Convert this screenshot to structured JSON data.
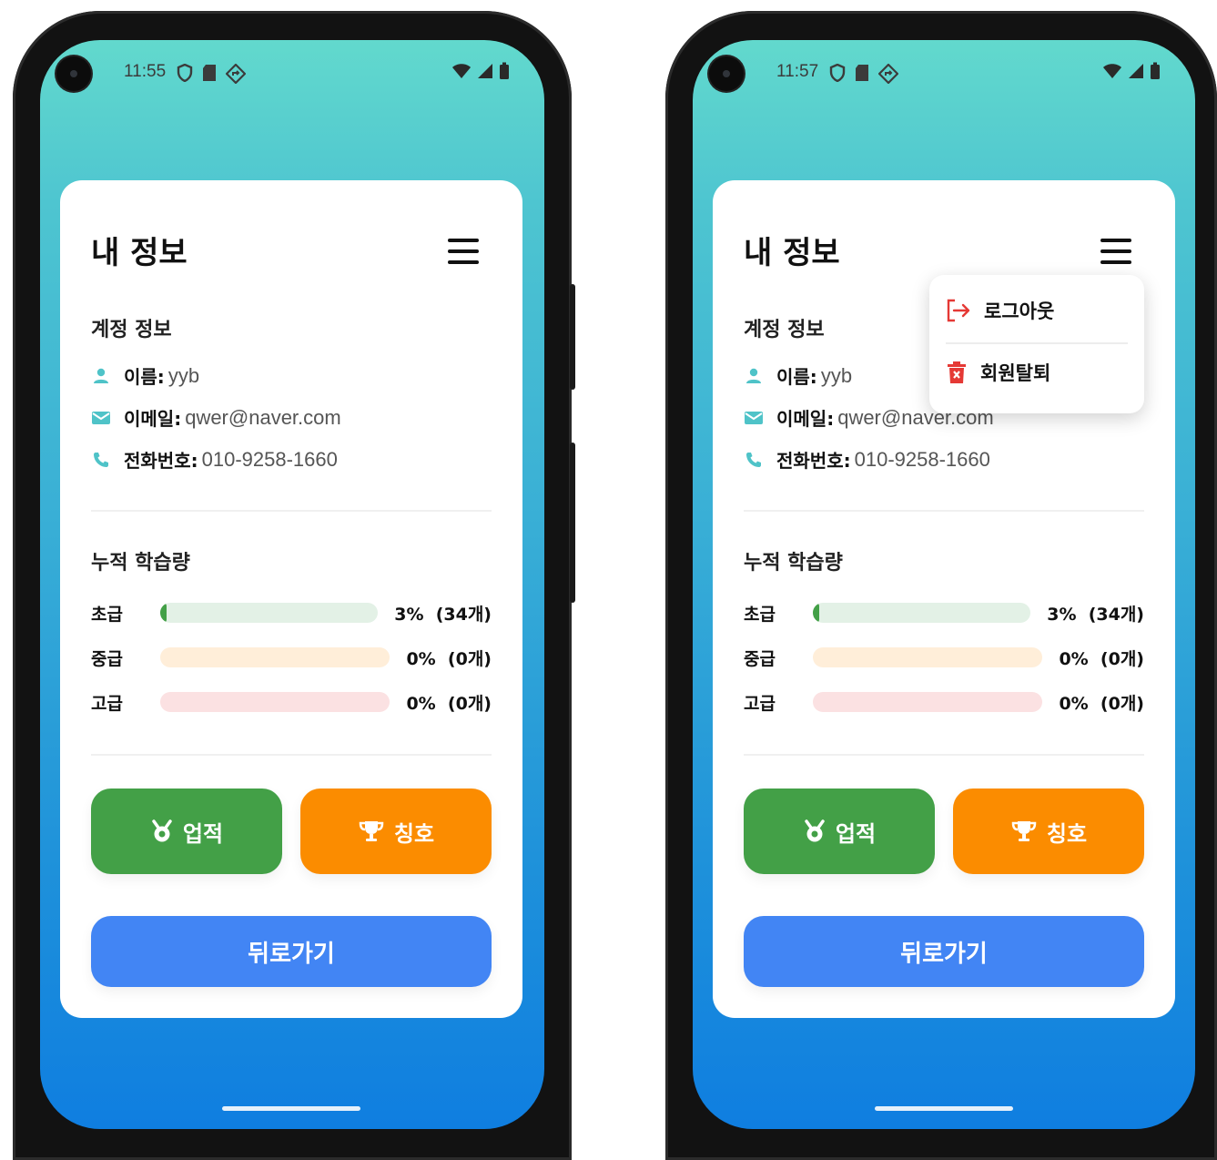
{
  "screens": [
    {
      "status": {
        "time": "11:55"
      },
      "title": "내 정보",
      "account": {
        "heading": "계정 정보",
        "name_label": "이름:",
        "name_value": "yyb",
        "email_label": "이메일:",
        "email_value": "qwer@naver.com",
        "phone_label": "전화번호:",
        "phone_value": "010-9258-1660"
      },
      "progress": {
        "heading": "누적 학습량",
        "rows": [
          {
            "label": "초급",
            "percent": 3,
            "text": "3%  (34개)",
            "track": "#e3f1e6",
            "fill": "#43a047"
          },
          {
            "label": "중급",
            "percent": 0,
            "text": "0%  (0개)",
            "track": "#ffeed9",
            "fill": "#fb8c00"
          },
          {
            "label": "고급",
            "percent": 0,
            "text": "0%  (0개)",
            "track": "#fbe1e2",
            "fill": "#e53935"
          }
        ]
      },
      "buttons": {
        "achievements": "업적",
        "titles": "칭호",
        "back": "뒤로가기"
      }
    },
    {
      "status": {
        "time": "11:57"
      },
      "title": "내 정보",
      "account": {
        "heading": "계정 정보",
        "name_label": "이름:",
        "name_value": "yyb",
        "email_label": "이메일:",
        "email_value": "qwer@naver.com",
        "phone_label": "전화번호:",
        "phone_value": "010-9258-1660"
      },
      "progress": {
        "heading": "누적 학습량",
        "rows": [
          {
            "label": "초급",
            "percent": 3,
            "text": "3%  (34개)",
            "track": "#e3f1e6",
            "fill": "#43a047"
          },
          {
            "label": "중급",
            "percent": 0,
            "text": "0%  (0개)",
            "track": "#ffeed9",
            "fill": "#fb8c00"
          },
          {
            "label": "고급",
            "percent": 0,
            "text": "0%  (0개)",
            "track": "#fbe1e2",
            "fill": "#e53935"
          }
        ]
      },
      "buttons": {
        "achievements": "업적",
        "titles": "칭호",
        "back": "뒤로가기"
      },
      "menu": {
        "logout": "로그아웃",
        "withdraw": "회원탈퇴"
      }
    }
  ],
  "colors": {
    "accent_teal": "#4fc3c8",
    "green": "#43a047",
    "orange": "#fb8c00",
    "blue": "#4285f4",
    "red": "#e53935"
  }
}
